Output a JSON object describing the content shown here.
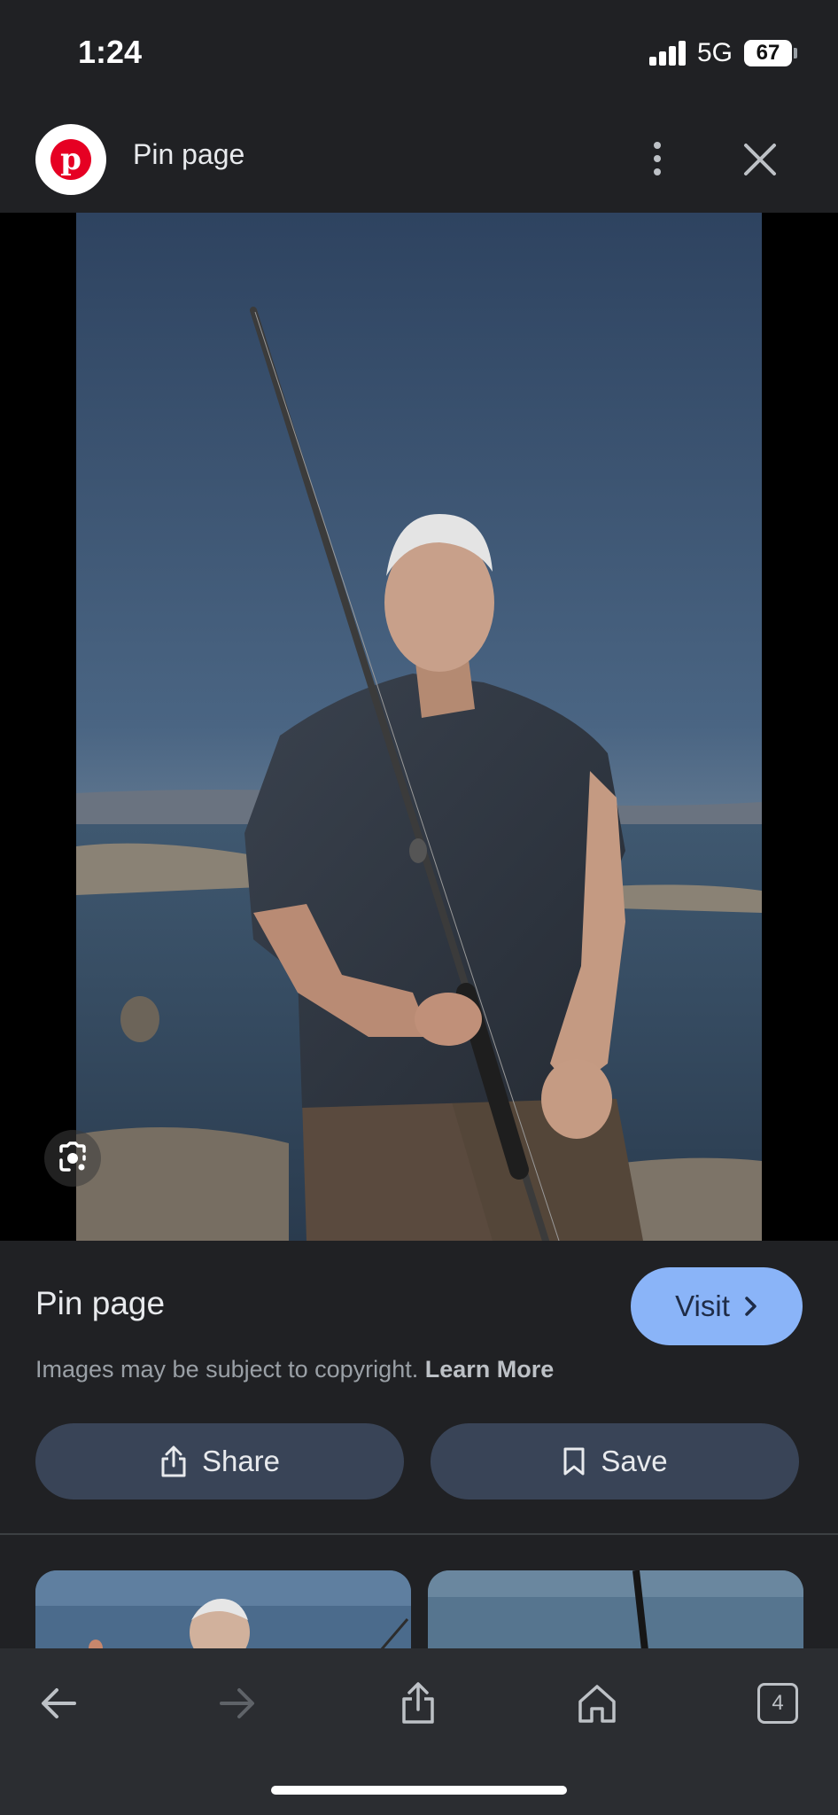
{
  "status_bar": {
    "time": "1:24",
    "network": "5G",
    "battery": "67"
  },
  "header": {
    "title": "Pin page",
    "site_icon": "pinterest-logo",
    "site_logo_letter": "p"
  },
  "result": {
    "title": "Pin page",
    "visit_label": "Visit",
    "copyright_text": "Images may be subject to copyright.",
    "learn_more_label": "Learn More",
    "share_label": "Share",
    "save_label": "Save"
  },
  "toolbar": {
    "tab_count": "4"
  },
  "colors": {
    "background": "#202124",
    "visit_button": "#8ab4f8",
    "action_button": "#394457",
    "toolbar": "#2b2d31",
    "pinterest_red": "#e60023"
  }
}
